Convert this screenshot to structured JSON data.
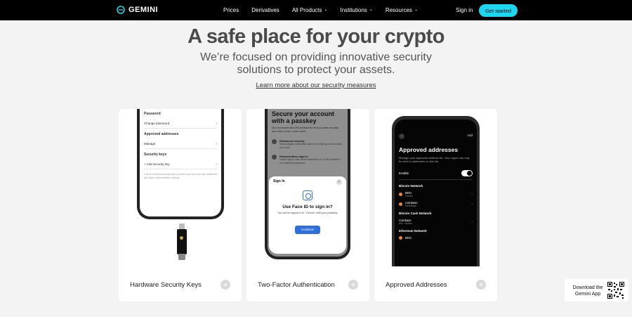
{
  "nav": {
    "logo_text": "GEMINI",
    "links": [
      {
        "label": "Prices",
        "dropdown": false
      },
      {
        "label": "Derivatives",
        "dropdown": false
      },
      {
        "label": "All Products",
        "dropdown": true
      },
      {
        "label": "Institutions",
        "dropdown": true
      },
      {
        "label": "Resources",
        "dropdown": true
      }
    ],
    "sign_in": "Sign in",
    "get_started": "Get started",
    "accent_color": "#1bd8f0"
  },
  "hero": {
    "title": "A safe place for your crypto",
    "subtitle": "We’re focused on providing innovative security solutions to protect your assets.",
    "link": "Learn more about our security measures"
  },
  "cards": [
    {
      "label": "Hardware Security Keys",
      "screen": {
        "password_heading": "Password",
        "change_password": "Change password",
        "approved_heading": "Approved addresses",
        "manage": "Manage",
        "keys_heading": "Security keys",
        "add_key": "+ Add security key",
        "footer": "Link an external security key to protect your account with additional two-factor authentication options."
      }
    },
    {
      "label": "Two-Factor Authentication",
      "screen": {
        "title": "Secure your account with a passkey",
        "intro": "Our recommended 2FA method for best-in-class security and ease of use. Learn more",
        "item1_title": "Enhanced security",
        "item1_text": "Strong digital credentials safe from phishing, server leaks, and more.",
        "item2_title": "Passwordless sign in",
        "item2_text": "Faster sign-in with device biometrics or a PIN instead of an email and password.",
        "sheet_title": "Sign In",
        "sheet_heading": "Use Face ID to sign in?",
        "sheet_sub": "You will be signed in to \"Gemini\" with your passkey.",
        "continue": "Continue"
      }
    },
    {
      "label": "Approved Addresses",
      "screen": {
        "add": "Add",
        "title": "Approved addresses",
        "desc": "Manage your approved address list. Your crypto can only be sent to addresses on this list.",
        "enable": "Enable",
        "sections": [
          {
            "name": "Bitcoin Network",
            "entries": [
              {
                "name": "BRO",
                "sub": "Gemini"
              },
              {
                "name": "Coinbase",
                "sub": "MetaMask"
              }
            ]
          },
          {
            "name": "Bitcoin Cash Network",
            "entries": [
              {
                "name": "Coinbase",
                "sub": "bitc...06dfab"
              }
            ]
          },
          {
            "name": "Ethereum Network",
            "entries": [
              {
                "name": "BRO",
                "sub": ""
              }
            ]
          }
        ]
      }
    }
  ],
  "download": {
    "text": "Download the Gemini App"
  }
}
